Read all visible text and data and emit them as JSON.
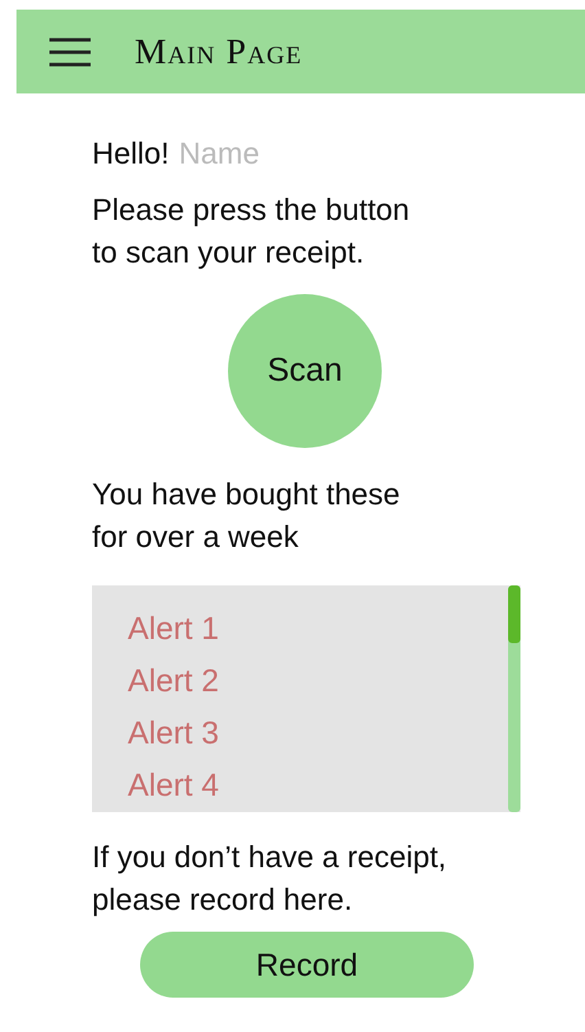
{
  "header": {
    "title": "Main Page"
  },
  "greeting": {
    "text": "Hello!",
    "user_name": "Name"
  },
  "scan_prompt": "Please press the button to scan your receipt.",
  "scan_button": "Scan",
  "alerts_heading": "You have bought these for over a week",
  "alerts": [
    {
      "text": "Alert 1"
    },
    {
      "text": "Alert 2"
    },
    {
      "text": "Alert 3"
    },
    {
      "text": "Alert 4"
    }
  ],
  "record_prompt": "If you don’t have a receipt, please record here.",
  "record_button": "Record"
}
